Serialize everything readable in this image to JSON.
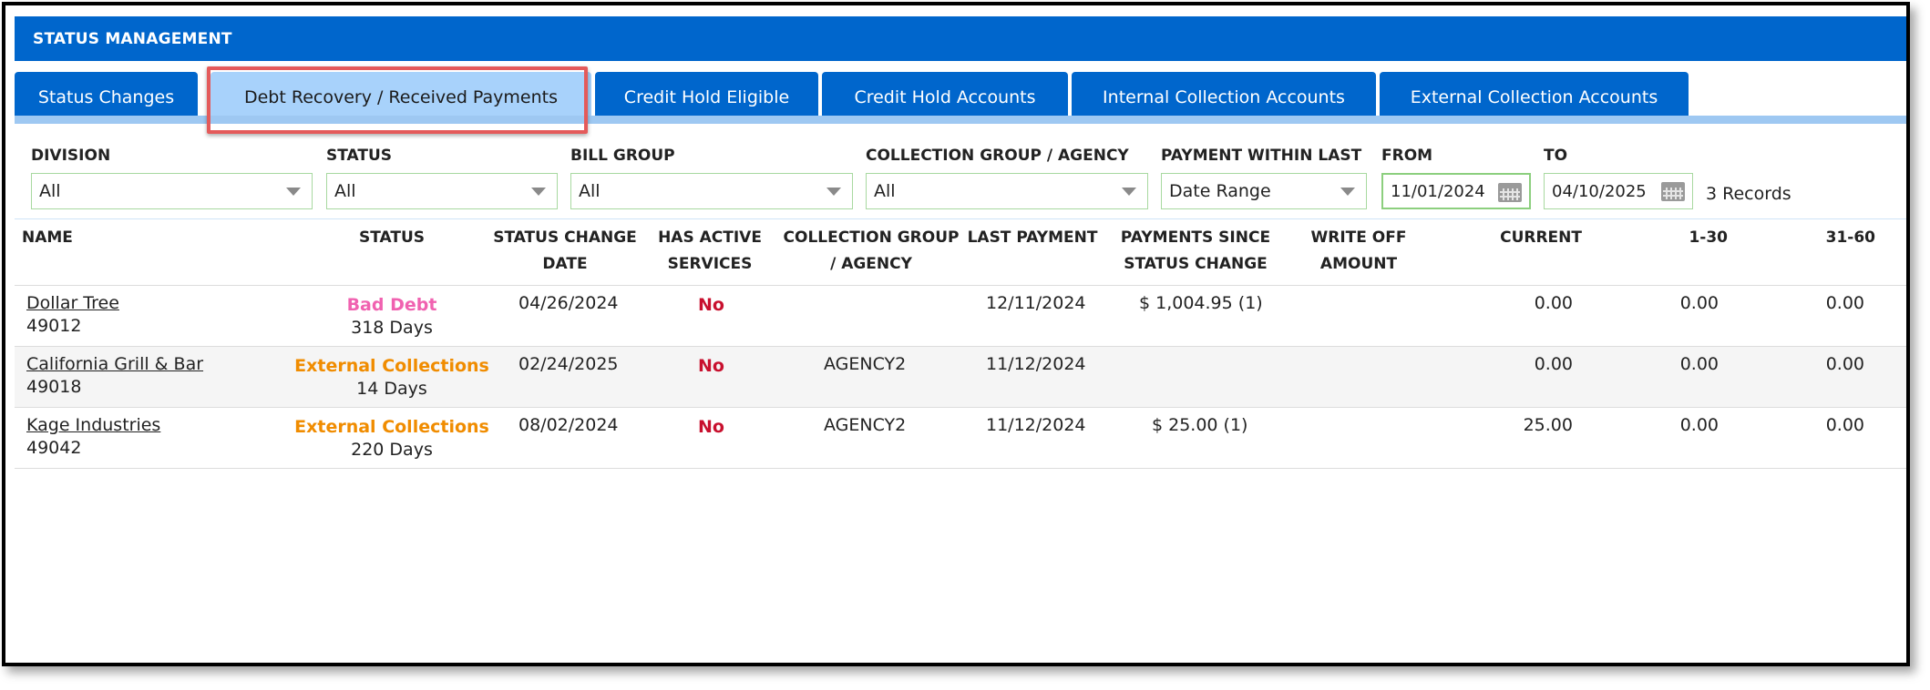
{
  "header": {
    "title": "STATUS MANAGEMENT"
  },
  "tabs": [
    {
      "label": "Status Changes"
    },
    {
      "label": "Debt Recovery / Received Payments"
    },
    {
      "label": "Credit Hold Eligible"
    },
    {
      "label": "Credit Hold Accounts"
    },
    {
      "label": "Internal Collection Accounts"
    },
    {
      "label": "External Collection Accounts"
    }
  ],
  "filters": {
    "division": {
      "label": "DIVISION",
      "value": "All"
    },
    "status": {
      "label": "STATUS",
      "value": "All"
    },
    "bill_group": {
      "label": "BILL GROUP",
      "value": "All"
    },
    "collection_group": {
      "label": "COLLECTION GROUP / AGENCY",
      "value": "All"
    },
    "payment_within": {
      "label": "PAYMENT WITHIN LAST",
      "value": "Date Range"
    },
    "from": {
      "label": "FROM",
      "value": "11/01/2024"
    },
    "to": {
      "label": "TO",
      "value": "04/10/2025"
    },
    "records": "3 Records"
  },
  "table": {
    "headers": {
      "name": "NAME",
      "status": "STATUS",
      "status_change_date_1": "STATUS CHANGE",
      "status_change_date_2": "DATE",
      "has_active_1": "HAS ACTIVE",
      "has_active_2": "SERVICES",
      "collection_group_1": "COLLECTION GROUP",
      "collection_group_2": "/ AGENCY",
      "last_payment": "LAST PAYMENT",
      "payments_since_1": "PAYMENTS SINCE",
      "payments_since_2": "STATUS CHANGE",
      "write_off_1": "WRITE OFF",
      "write_off_2": "AMOUNT",
      "current": "CURRENT",
      "d1_30": "1-30",
      "d31_60": "31-60"
    },
    "rows": [
      {
        "name": "Dollar Tree",
        "id": "49012",
        "status": "Bad Debt",
        "days": "318 Days",
        "status_date": "04/26/2024",
        "has_active": "No",
        "collection_group": "",
        "last_payment": "12/11/2024",
        "payments_since": "$ 1,004.95 (1)",
        "write_off": "",
        "current": "0.00",
        "d1_30": "0.00",
        "d31_60": "0.00"
      },
      {
        "name": "California Grill & Bar",
        "id": "49018",
        "status": "External Collections",
        "days": "14 Days",
        "status_date": "02/24/2025",
        "has_active": "No",
        "collection_group": "AGENCY2",
        "last_payment": "11/12/2024",
        "payments_since": "",
        "write_off": "",
        "current": "0.00",
        "d1_30": "0.00",
        "d31_60": "0.00"
      },
      {
        "name": "Kage Industries",
        "id": "49042",
        "status": "External Collections",
        "days": "220 Days",
        "status_date": "08/02/2024",
        "has_active": "No",
        "collection_group": "AGENCY2",
        "last_payment": "11/12/2024",
        "payments_since": "$ 25.00 (1)",
        "write_off": "",
        "current": "25.00",
        "d1_30": "0.00",
        "d31_60": "0.00"
      }
    ]
  },
  "colors": {
    "header_blue": "#0066cc",
    "active_tab": "#a8d2fb",
    "bad_debt": "#f062b0",
    "external_collections": "#f08c00",
    "no": "#c8102e",
    "highlight_border": "#e45a5a"
  }
}
